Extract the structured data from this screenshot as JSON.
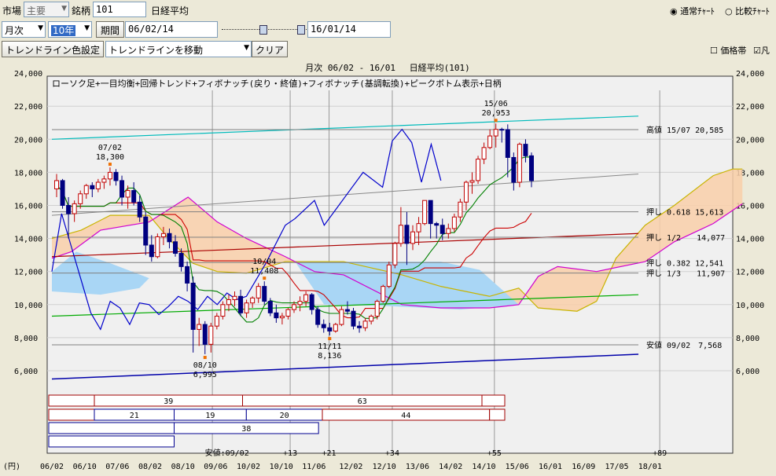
{
  "toolbar1": {
    "market_label": "市場",
    "market_value": "主要",
    "symbol_label": "銘柄",
    "symbol_value": "101",
    "symbol_name": "日経平均",
    "radio_normal": "通常ﾁｬｰﾄ",
    "radio_compare": "比較ﾁｬｰﾄ"
  },
  "toolbar2": {
    "interval": "月次",
    "span": "10年",
    "period_button": "期間",
    "start_date": "06/02/14",
    "end_date": "16/01/14"
  },
  "toolbar3": {
    "color_button": "トレンドライン色設定",
    "move_select": "トレンドラインを移動",
    "clear_button": "クリア",
    "price_band": "価格帯",
    "check2": "凡"
  },
  "chart_data": {
    "type": "candlestick",
    "title": "月次 06/02 - 16/01　 日経平均(101)",
    "subtitle": "ローソク足+一目均衡+回帰トレンド+フィボナッチ(戻り・終値)+フィボナッチ(基調転換)+ピークボトム表示+日柄",
    "ylim": [
      5000,
      23000
    ],
    "y_ticks": [
      6000,
      8000,
      10000,
      12000,
      14000,
      16000,
      18000,
      20000,
      22000
    ],
    "y_tick_labels": [
      "6,000",
      "8,000",
      "10,000",
      "12,000",
      "14,000",
      "16,000",
      "18,000",
      "20,000",
      "22,000"
    ],
    "y_top_partial": "24,000",
    "unit_label": "(円)",
    "x_tick_labels": [
      "06/02",
      "06/10",
      "07/06",
      "08/02",
      "08/10",
      "09/06",
      "10/02",
      "10/10",
      "11/06",
      "12/02",
      "12/10",
      "13/06",
      "14/02",
      "14/10",
      "15/06",
      "16/01",
      "16/09",
      "17/05",
      "18/01"
    ],
    "candles": [
      [
        17000,
        17900,
        16500,
        17500
      ],
      [
        17500,
        17600,
        15800,
        16000
      ],
      [
        16000,
        16500,
        14000,
        15500
      ],
      [
        15500,
        16300,
        15000,
        16100
      ],
      [
        16100,
        16900,
        15800,
        16700
      ],
      [
        16700,
        17300,
        16400,
        17200
      ],
      [
        17200,
        17400,
        16500,
        17000
      ],
      [
        17000,
        17600,
        16800,
        17400
      ],
      [
        17400,
        17800,
        17000,
        17600
      ],
      [
        17600,
        18300,
        17200,
        18000
      ],
      [
        18000,
        18200,
        17200,
        17500
      ],
      [
        17500,
        17800,
        16000,
        16500
      ],
      [
        16500,
        17200,
        15800,
        16900
      ],
      [
        16900,
        17400,
        16000,
        16200
      ],
      [
        16200,
        16600,
        15000,
        15300
      ],
      [
        15300,
        15600,
        13000,
        13600
      ],
      [
        13600,
        14200,
        12600,
        12900
      ],
      [
        12900,
        14300,
        12800,
        14100
      ],
      [
        14100,
        14700,
        13600,
        14300
      ],
      [
        14300,
        14600,
        13400,
        13800
      ],
      [
        13800,
        14200,
        12900,
        13100
      ],
      [
        13100,
        13400,
        12000,
        12300
      ],
      [
        12300,
        12600,
        10800,
        11300
      ],
      [
        11300,
        11700,
        7100,
        8500
      ],
      [
        8500,
        9200,
        7500,
        8800
      ],
      [
        8800,
        9000,
        7000,
        7600
      ],
      [
        7600,
        8900,
        7100,
        8700
      ],
      [
        8700,
        9500,
        8500,
        9300
      ],
      [
        9300,
        10200,
        9100,
        10000
      ],
      [
        10000,
        10600,
        9600,
        10300
      ],
      [
        10300,
        10800,
        9900,
        10500
      ],
      [
        10500,
        10900,
        9300,
        9500
      ],
      [
        9500,
        10300,
        9200,
        10100
      ],
      [
        10100,
        10500,
        9800,
        10400
      ],
      [
        10400,
        11300,
        10100,
        11100
      ],
      [
        11100,
        11408,
        10000,
        10200
      ],
      [
        10200,
        10400,
        9300,
        9500
      ],
      [
        9500,
        10000,
        8900,
        9200
      ],
      [
        9200,
        9500,
        8800,
        9300
      ],
      [
        9300,
        9800,
        9100,
        9700
      ],
      [
        9700,
        10200,
        9500,
        10000
      ],
      [
        10000,
        10500,
        9600,
        10200
      ],
      [
        10200,
        10800,
        9900,
        10600
      ],
      [
        10600,
        10700,
        9400,
        9700
      ],
      [
        9700,
        9900,
        8600,
        8800
      ],
      [
        8800,
        9100,
        8300,
        8600
      ],
      [
        8600,
        8900,
        8136,
        8400
      ],
      [
        8400,
        8900,
        8300,
        8800
      ],
      [
        8800,
        9900,
        8700,
        9700
      ],
      [
        9700,
        10200,
        9400,
        9600
      ],
      [
        9600,
        9800,
        8500,
        8700
      ],
      [
        8700,
        9000,
        8300,
        8600
      ],
      [
        8600,
        9200,
        8400,
        9000
      ],
      [
        9000,
        9400,
        8800,
        9300
      ],
      [
        9300,
        10300,
        9100,
        10200
      ],
      [
        10200,
        11200,
        10100,
        11100
      ],
      [
        11100,
        12600,
        11000,
        12400
      ],
      [
        12400,
        13800,
        12200,
        13700
      ],
      [
        13700,
        15900,
        13500,
        14800
      ],
      [
        14800,
        15600,
        12400,
        13700
      ],
      [
        13700,
        14800,
        13300,
        14400
      ],
      [
        14400,
        15300,
        13600,
        14900
      ],
      [
        14900,
        16300,
        14800,
        16300
      ],
      [
        16300,
        16300,
        14000,
        14900
      ],
      [
        14900,
        15000,
        14000,
        14800
      ],
      [
        14800,
        15200,
        13900,
        14300
      ],
      [
        14300,
        14900,
        14000,
        14600
      ],
      [
        14600,
        15500,
        14400,
        15300
      ],
      [
        15300,
        16400,
        15000,
        16200
      ],
      [
        16200,
        17500,
        15700,
        17400
      ],
      [
        17400,
        18000,
        16700,
        17500
      ],
      [
        17500,
        19000,
        17300,
        18800
      ],
      [
        18800,
        19800,
        18500,
        19500
      ],
      [
        19500,
        20600,
        19400,
        20200
      ],
      [
        20200,
        20953,
        19500,
        20600
      ],
      [
        20600,
        20700,
        19800,
        20585
      ],
      [
        20585,
        20900,
        17700,
        18900
      ],
      [
        18900,
        19200,
        16900,
        17400
      ],
      [
        17400,
        19800,
        17100,
        19700
      ],
      [
        19700,
        20000,
        18600,
        19000
      ],
      [
        19000,
        19200,
        17100,
        17500
      ]
    ],
    "peaks": [
      {
        "date": "07/02",
        "value": "18,300"
      },
      {
        "date": "10/04",
        "value": "11,408"
      },
      {
        "date": "15/06",
        "value": "20,953"
      }
    ],
    "bottoms": [
      {
        "date": "08/10",
        "value": "6,995"
      },
      {
        "date": "11/11",
        "value": "8,136"
      }
    ],
    "fib_levels": [
      {
        "label": "高値 15/07 20,585",
        "value": 20585
      },
      {
        "label": "押し 0.618 15,613",
        "value": 15613
      },
      {
        "label": "押し 1/2　　14,077",
        "value": 14077
      },
      {
        "label": "押し 0.382 12,541",
        "value": 12541
      },
      {
        "label": "押し 1/3　　11,907",
        "value": 11907
      },
      {
        "label": "安値 09/02　7,568",
        "value": 7568
      }
    ],
    "hiyori_rows": [
      [
        {
          "label": "",
          "start": 0,
          "end": 12
        },
        {
          "label": "39",
          "start": 12,
          "end": 51
        },
        {
          "label": "63",
          "start": 51,
          "end": 114
        },
        {
          "label": "",
          "start": 114,
          "end": 120
        }
      ],
      [
        {
          "label": "",
          "start": 0,
          "end": 12
        },
        {
          "label": "21",
          "start": 12,
          "end": 33
        },
        {
          "label": "19",
          "start": 33,
          "end": 52
        },
        {
          "label": "20",
          "start": 52,
          "end": 72
        },
        {
          "label": "44",
          "start": 72,
          "end": 116
        },
        {
          "label": "",
          "start": 116,
          "end": 120
        }
      ],
      [
        {
          "label": "",
          "start": 0,
          "end": 33
        },
        {
          "label": "38",
          "start": 33,
          "end": 71
        }
      ],
      [
        {
          "label": "",
          "start": 0,
          "end": 33
        }
      ]
    ],
    "hiyori_marks": [
      {
        "label": "安値:09/02",
        "x": 36
      },
      {
        "label": "+13",
        "x": 49
      },
      {
        "label": "+21",
        "x": 57
      },
      {
        "label": "+34",
        "x": 70
      },
      {
        "label": "+55",
        "x": 91
      },
      {
        "label": "+89",
        "x": 125
      }
    ],
    "colors": {
      "up": "#c00000",
      "down": "#000080",
      "tenkan": "#cc0000",
      "kijun": "#008000",
      "chikou": "#0000cc",
      "senkouA": "#c8b400",
      "senkouB": "#d000d0",
      "kumo_bull": "#f9cfa9",
      "kumo_bear": "#a9d6f5",
      "reg_low": "#0000aa",
      "reg_mid": "#00aa00",
      "reg_high": "#00bbbb",
      "fib_half": "#aa0000",
      "fib_gray": "#808080"
    }
  }
}
